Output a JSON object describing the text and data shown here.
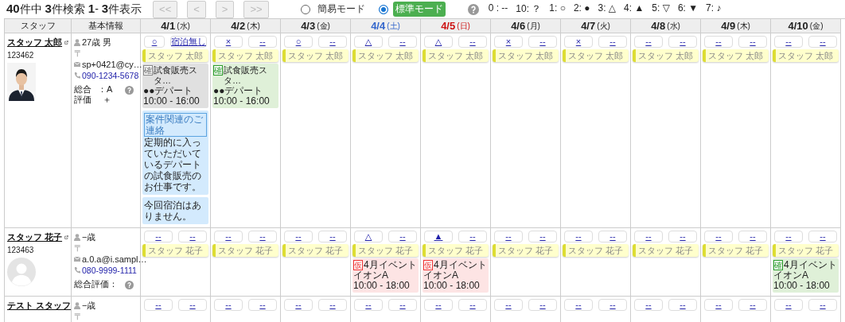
{
  "summary": "**40**件中 **3**件検索 **1**- **3**件表示",
  "pager": [
    {
      "label": "<<",
      "disabled": true
    },
    {
      "label": "<",
      "disabled": true
    },
    {
      "label": ">",
      "disabled": true
    },
    {
      "label": ">>",
      "disabled": true
    }
  ],
  "modes": [
    {
      "label": "簡易モード",
      "selected": false
    },
    {
      "label": "標準モード",
      "selected": true
    }
  ],
  "legend": [
    "0 : --",
    "10: ？",
    "1: ○",
    "2: ●",
    "3: △",
    "4: ▲",
    "5: ▽",
    "6: ▼",
    "7: ♪"
  ],
  "columns": {
    "staff": "スタッフ",
    "info": "基本情報"
  },
  "days": [
    {
      "date": "4/1",
      "weekday": "(水)",
      "kind": "weekday"
    },
    {
      "date": "4/2",
      "weekday": "(木)",
      "kind": "weekday"
    },
    {
      "date": "4/3",
      "weekday": "(金)",
      "kind": "weekday"
    },
    {
      "date": "4/4",
      "weekday": "(土)",
      "kind": "saturday"
    },
    {
      "date": "4/5",
      "weekday": "(日)",
      "kind": "sunday"
    },
    {
      "date": "4/6",
      "weekday": "(月)",
      "kind": "weekday"
    },
    {
      "date": "4/7",
      "weekday": "(火)",
      "kind": "weekday"
    },
    {
      "date": "4/8",
      "weekday": "(水)",
      "kind": "weekday"
    },
    {
      "date": "4/9",
      "weekday": "(木)",
      "kind": "weekday"
    },
    {
      "date": "4/10",
      "weekday": "(金)",
      "kind": "weekday"
    }
  ],
  "staff": [
    {
      "name": "スタッフ 太郎",
      "id": "123462",
      "age": "27歳 男",
      "postal": "〒",
      "email": "sp+0421@cy…",
      "phone": "090-1234-5678",
      "rating_label": "総合評価",
      "rating_value": "：A",
      "rating_extra": "＋",
      "cells": [
        {
          "availability": "○",
          "lodging": "宿泊無し",
          "note": "スタッフ 太郎",
          "jobs": [
            {
              "kind": "done",
              "badge": "確",
              "title": "試食販売スタ…",
              "place": "●●デパート",
              "time": "10:00 - 16:00"
            }
          ],
          "memos": [
            {
              "title": "案件関連のご連絡",
              "text": "定期的に入っていただいているデパートの試食販売のお仕事です。"
            },
            {
              "text": "今回宿泊はありません。"
            }
          ]
        },
        {
          "availability": "×",
          "lodging": "--",
          "note": "スタッフ 太郎",
          "jobs": [
            {
              "kind": "confirmed",
              "badge": "確",
              "title": "試食販売スタ…",
              "place": "●●デパート",
              "time": "10:00 - 16:00"
            }
          ]
        },
        {
          "availability": "○",
          "lodging": "--",
          "note": "スタッフ 太郎"
        },
        {
          "availability": "△",
          "lodging": "--",
          "note": "スタッフ 太郎"
        },
        {
          "availability": "△",
          "lodging": "--",
          "note": "スタッフ 太郎"
        },
        {
          "availability": "×",
          "lodging": "--",
          "note": "スタッフ 太郎"
        },
        {
          "availability": "×",
          "lodging": "--",
          "note": "スタッフ 太郎"
        },
        {
          "availability": "--",
          "lodging": "--",
          "note": "スタッフ 太郎"
        },
        {
          "availability": "--",
          "lodging": "--",
          "note": "スタッフ 太郎"
        },
        {
          "availability": "--",
          "lodging": "--",
          "note": "スタッフ 太郎"
        }
      ]
    },
    {
      "name": "スタッフ 花子",
      "id": "123463",
      "avatar": {
        "kind": "placeholder"
      },
      "age": "−歳",
      "postal": "〒",
      "email": "a.0.a@i.sampl…",
      "phone": "080-9999-1111",
      "rating_label": "総合評価：",
      "cells": [
        {
          "availability": "--",
          "lodging": "--",
          "note": "スタッフ 花子"
        },
        {
          "availability": "--",
          "lodging": "--",
          "note": "スタッフ 花子"
        },
        {
          "availability": "--",
          "lodging": "--",
          "note": "スタッフ 花子"
        },
        {
          "availability": "△",
          "lodging": "--",
          "note": "スタッフ 花子",
          "jobs": [
            {
              "kind": "tentative",
              "badge": "仮",
              "title": "4月イベント",
              "place": "イオンA",
              "time": "10:00 - 18:00"
            }
          ]
        },
        {
          "availability": "▲",
          "lodging": "--",
          "note": "スタッフ 花子",
          "jobs": [
            {
              "kind": "tentative",
              "badge": "仮",
              "title": "4月イベント",
              "place": "イオンA",
              "time": "10:00 - 18:00"
            }
          ]
        },
        {
          "availability": "--",
          "lodging": "--",
          "note": "スタッフ 花子"
        },
        {
          "availability": "--",
          "lodging": "--",
          "note": "スタッフ 花子"
        },
        {
          "availability": "--",
          "lodging": "--",
          "note": "スタッフ 花子"
        },
        {
          "availability": "--",
          "lodging": "--",
          "note": "スタッフ 花子"
        },
        {
          "availability": "--",
          "lodging": "--",
          "note": "スタッフ 花子",
          "jobs": [
            {
              "kind": "confirmed",
              "badge": "確",
              "title": "4月イベント",
              "place": "イオンA",
              "time": "10:00 - 18:00"
            }
          ]
        }
      ]
    },
    {
      "name": "テスト スタッフ",
      "age": "−歳",
      "postal": "〒",
      "cells": [
        {
          "availability": "--",
          "lodging": "--"
        },
        {
          "availability": "--",
          "lodging": "--"
        },
        {
          "availability": "--",
          "lodging": "--"
        },
        {
          "availability": "--",
          "lodging": "--"
        },
        {
          "availability": "--",
          "lodging": "--"
        },
        {
          "availability": "--",
          "lodging": "--"
        },
        {
          "availability": "--",
          "lodging": "--"
        },
        {
          "availability": "--",
          "lodging": "--"
        },
        {
          "availability": "--",
          "lodging": "--"
        },
        {
          "availability": "--",
          "lodging": "--"
        }
      ]
    }
  ]
}
